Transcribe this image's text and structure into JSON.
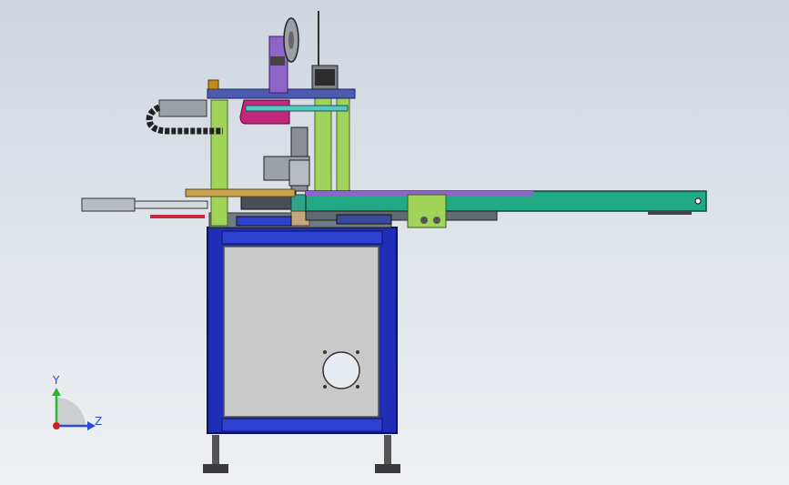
{
  "view": {
    "title": "",
    "background_top": "#cfd6e0",
    "background_bottom": "#eef0f3"
  },
  "model": {
    "frame_color": "#1f2fb5",
    "panel_color": "#c8c8c8",
    "pillar_color": "#9fd35a",
    "conveyor_color": "#21a984",
    "accent_magenta": "#c0287c",
    "accent_purple": "#8e64c8"
  },
  "triad": {
    "y_label": "Y",
    "z_label": "Z",
    "y_color": "#2fb52f",
    "z_color": "#2b4ad8",
    "origin_color": "#d01e1e"
  }
}
